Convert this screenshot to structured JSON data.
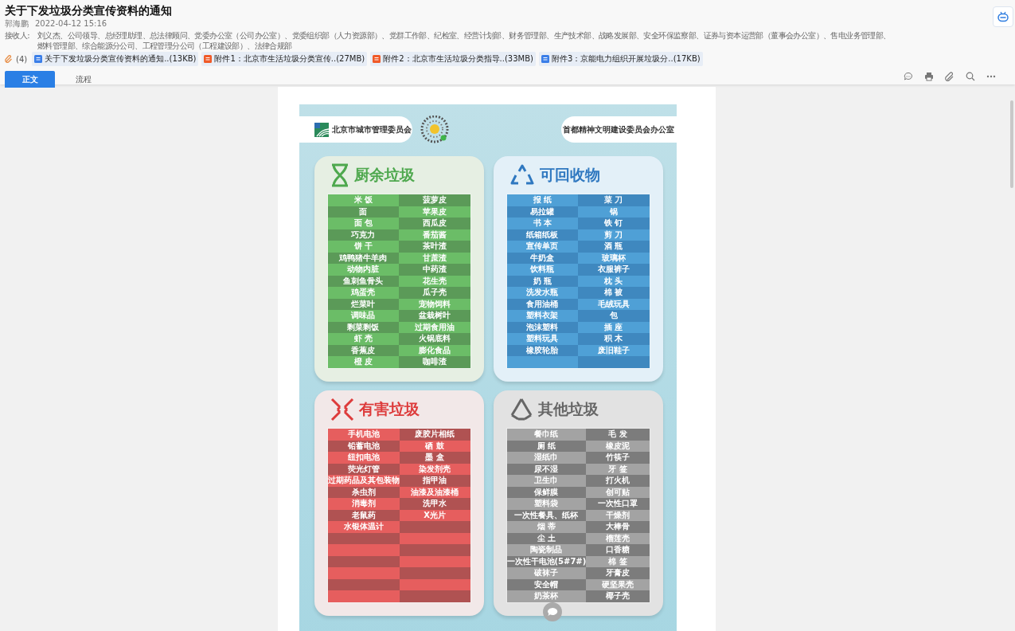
{
  "title": "关于下发垃圾分类宣传资料的通知",
  "author": "郭海鹏",
  "date": "2022-04-12 15:16",
  "recipients_label": "接收人:",
  "recipients": "刘义杰、公司领导、总经理助理、总法律顾问、党委办公室（公司办公室）、党委组织部（人力资源部）、党群工作部、纪检室、经营计划部、财务管理部、生产技术部、战略发展部、安全环保监察部、证券与资本运营部（董事会办公室）、售电业务管理部、燃料管理部、综合能源分公司、工程管理分公司（工程建设部）、法律合规部",
  "attachment_count": "(4)",
  "attachments": [
    {
      "kind": "word",
      "name": "关于下发垃圾分类宣传资料的通知..(13KB)"
    },
    {
      "kind": "pdf",
      "name": "附件1：北京市生活垃圾分类宣传..(27MB)"
    },
    {
      "kind": "pdf",
      "name": "附件2：北京市生活垃圾分类指导..(33MB)"
    },
    {
      "kind": "word",
      "name": "附件3：京能电力组织开展垃圾分..(17KB)"
    }
  ],
  "tabs": [
    {
      "label": "正文",
      "selected": true
    },
    {
      "label": "流程",
      "selected": false
    }
  ],
  "poster": {
    "issuer_left": "北京市城市管理委员会",
    "issuer_right": "首都精神文明建设委员会办公室",
    "categories": [
      {
        "kind": "food",
        "title": "厨余垃圾",
        "rows": [
          {
            "left": "米 饭",
            "right": "菠萝皮"
          },
          {
            "left": "面",
            "right": "苹果皮"
          },
          {
            "left": "面 包",
            "right": "西瓜皮"
          },
          {
            "left": "巧克力",
            "right": "番茄酱"
          },
          {
            "left": "饼 干",
            "right": "茶叶渣"
          },
          {
            "left": "鸡鸭猪牛羊肉",
            "right": "甘蔗渣"
          },
          {
            "left": "动物内脏",
            "right": "中药渣"
          },
          {
            "left": "鱼刺鱼骨头",
            "right": "花生壳"
          },
          {
            "left": "鸡蛋壳",
            "right": "瓜子壳"
          },
          {
            "left": "烂菜叶",
            "right": "宠物饲料"
          },
          {
            "left": "调味品",
            "right": "盆栽树叶"
          },
          {
            "left": "剩菜剩饭",
            "right": "过期食用油"
          },
          {
            "left": "虾 壳",
            "right": "火锅底料"
          },
          {
            "left": "香蕉皮",
            "right": "膨化食品"
          },
          {
            "left": "橙 皮",
            "right": "咖啡渣"
          }
        ]
      },
      {
        "kind": "recyclable",
        "title": "可回收物",
        "rows": [
          {
            "left": "报 纸",
            "right": "菜 刀"
          },
          {
            "left": "易拉罐",
            "right": "锅"
          },
          {
            "left": "书 本",
            "right": "铁 钉"
          },
          {
            "left": "纸箱纸板",
            "right": "剪 刀"
          },
          {
            "left": "宣传单页",
            "right": "酒 瓶"
          },
          {
            "left": "牛奶盒",
            "right": "玻璃杯"
          },
          {
            "left": "饮料瓶",
            "right": "衣服裤子"
          },
          {
            "left": "奶 瓶",
            "right": "枕 头"
          },
          {
            "left": "洗发水瓶",
            "right": "棉 被"
          },
          {
            "left": "食用油桶",
            "right": "毛绒玩具"
          },
          {
            "left": "塑料衣架",
            "right": "包"
          },
          {
            "left": "泡沫塑料",
            "right": "插 座"
          },
          {
            "left": "塑料玩具",
            "right": "积 木"
          },
          {
            "left": "橡胶轮胎",
            "right": "废旧鞋子"
          },
          {}
        ]
      },
      {
        "kind": "hazardous",
        "title": "有害垃圾",
        "rows": [
          {
            "left": "手机电池",
            "right": "废胶片相纸"
          },
          {
            "left": "铅蓄电池",
            "right": "硒 鼓"
          },
          {
            "left": "纽扣电池",
            "right": "墨 盒"
          },
          {
            "left": "荧光灯管",
            "right": "染发剂壳"
          },
          {
            "left": "过期药品及其包装物",
            "right": "指甲油"
          },
          {
            "left": "杀虫剂",
            "right": "油漆及油漆桶"
          },
          {
            "left": "消毒剂",
            "right": "洗甲水"
          },
          {
            "left": "老鼠药",
            "right": "X光片"
          },
          {
            "left": "水银体温计"
          },
          {},
          {},
          {},
          {},
          {},
          {}
        ]
      },
      {
        "kind": "other",
        "title": "其他垃圾",
        "rows": [
          {
            "left": "餐巾纸",
            "right": "毛 发"
          },
          {
            "left": "厕 纸",
            "right": "橡皮泥"
          },
          {
            "left": "湿纸巾",
            "right": "竹筷子"
          },
          {
            "left": "尿不湿",
            "right": "牙 签"
          },
          {
            "left": "卫生巾",
            "right": "打火机"
          },
          {
            "left": "保鲜膜",
            "right": "创可贴"
          },
          {
            "left": "塑料袋",
            "right": "一次性口罩"
          },
          {
            "left": "一次性餐具、纸杯",
            "right": "干燥剂"
          },
          {
            "left": "烟 蒂",
            "right": "大棒骨"
          },
          {
            "left": "尘 土",
            "right": "榴莲壳"
          },
          {
            "left": "陶瓷制品",
            "right": "口香糖"
          },
          {
            "left": "一次性干电池(5#7#)",
            "right": "棉 签"
          },
          {
            "left": "破袜子",
            "right": "牙膏皮"
          },
          {
            "left": "安全帽",
            "right": "硬坚果壳"
          },
          {
            "left": "奶茶杯",
            "right": "椰子壳"
          }
        ]
      }
    ]
  }
}
